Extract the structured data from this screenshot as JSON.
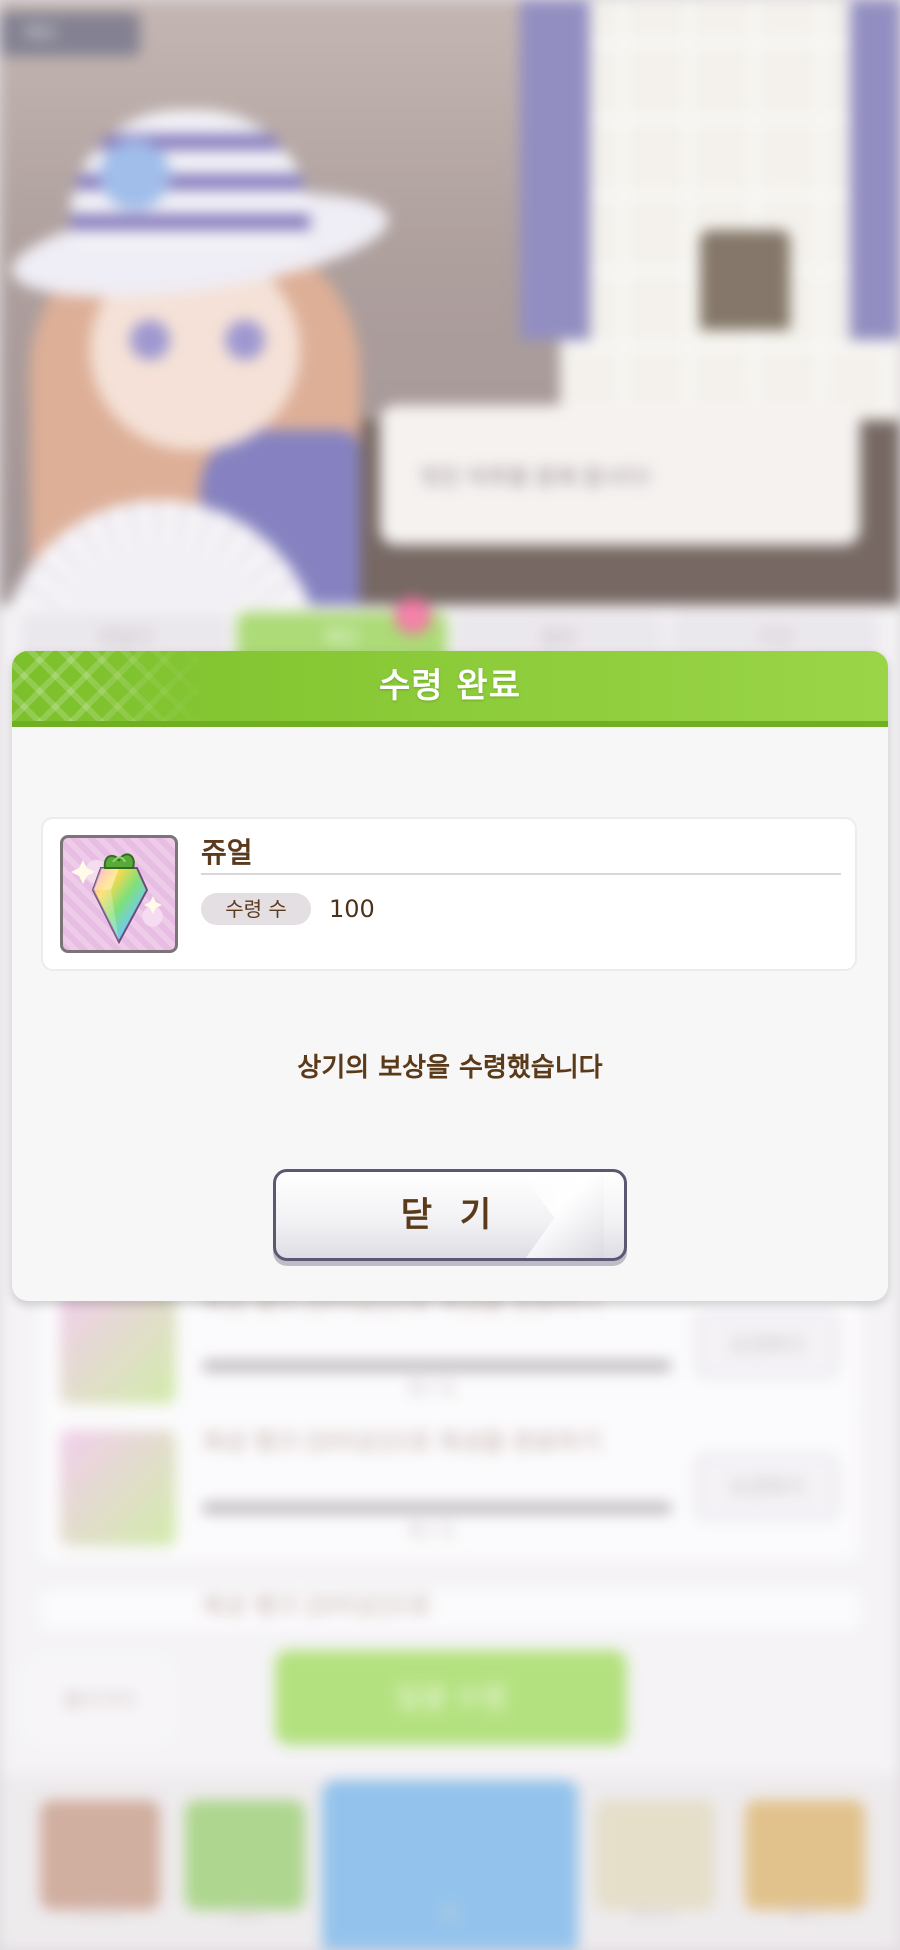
{
  "background": {
    "top_badge": "메모",
    "speech_text": "멋진 하루를 함께 합시다!",
    "tabs": [
      "데일리",
      "메인",
      "일반",
      "기간"
    ],
    "tab_badge": "1",
    "missions": [
      {
        "title": "육성 랭크 [D이상]으로 육성을 완료하기",
        "count": "0 / 1",
        "button": "도전하기"
      },
      {
        "title": "육성 랭크 [D이상]으로 육성을 완료하기",
        "count": "0 / 1",
        "button": "도전하기"
      },
      {
        "title": "육성 랭크 [D이상]으로",
        "count": "",
        "button": ""
      }
    ],
    "back_button": "돌아가다",
    "claim_all_button": "일괄 수령",
    "nav_items": [
      "캐릭터",
      "강화",
      "홈",
      "레이스",
      "뽑기"
    ]
  },
  "dialog": {
    "title": "수령 완료",
    "reward": {
      "name": "쥬얼",
      "quantity_label": "수령 수",
      "quantity_value": "100",
      "icon": "jewel-icon"
    },
    "message": "상기의 보상을 수령했습니다",
    "close_button": "닫 기"
  },
  "colors": {
    "header_green": "#8ccb39",
    "text_brown": "#5a3a18",
    "dialog_bg": "#f7f7f7"
  }
}
